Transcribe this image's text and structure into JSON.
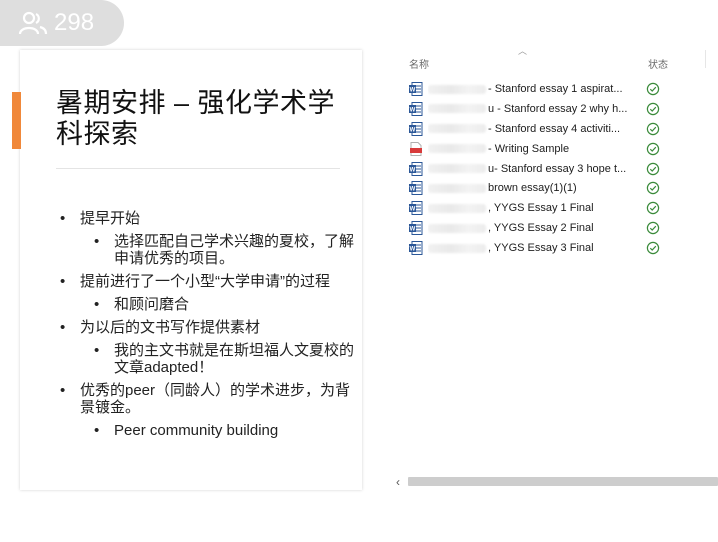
{
  "viewer": {
    "icon": "people-icon",
    "count": "298"
  },
  "slide": {
    "title": "暑期安排 – 强化学术学科探索",
    "accent_color": "#f0883a",
    "bullets": [
      {
        "text": "提早开始",
        "sub": [
          "选择匹配自己学术兴趣的夏校，了解申请优秀的项目。"
        ]
      },
      {
        "text": "提前进行了一个小型“大学申请”的过程",
        "sub": [
          "和顾问磨合"
        ]
      },
      {
        "text": "为以后的文书写作提供素材",
        "sub": [
          "我的主文书就是在斯坦福人文夏校的文章adapted！"
        ]
      },
      {
        "text": "优秀的peer（同龄人）的学术进步，为背景镀金。",
        "sub": [
          "Peer community building"
        ]
      }
    ]
  },
  "filelist": {
    "col_name": "名称",
    "col_status": "状态",
    "files": [
      {
        "name": "- Stanford essay 1 aspirat...",
        "icon": "word-doc-icon"
      },
      {
        "name": "u - Stanford essay 2 why h...",
        "icon": "word-doc-icon"
      },
      {
        "name": "- Stanford essay 4 activiti...",
        "icon": "word-doc-icon"
      },
      {
        "name": "- Writing Sample",
        "icon": "pdf-icon"
      },
      {
        "name": "u- Stanford essay 3 hope t...",
        "icon": "word-doc-icon"
      },
      {
        "name": "brown essay(1)(1)",
        "icon": "word-doc-icon"
      },
      {
        "name": ", YYGS Essay 1 Final",
        "icon": "word-doc-icon"
      },
      {
        "name": ", YYGS Essay 2 Final",
        "icon": "word-doc-icon"
      },
      {
        "name": ", YYGS Essay 3 Final",
        "icon": "word-doc-icon"
      }
    ],
    "status_icon": "synced-check-icon",
    "word_color": "#2b5797",
    "pdf_color": "#d83b3b",
    "check_color": "#3a8a3a"
  }
}
